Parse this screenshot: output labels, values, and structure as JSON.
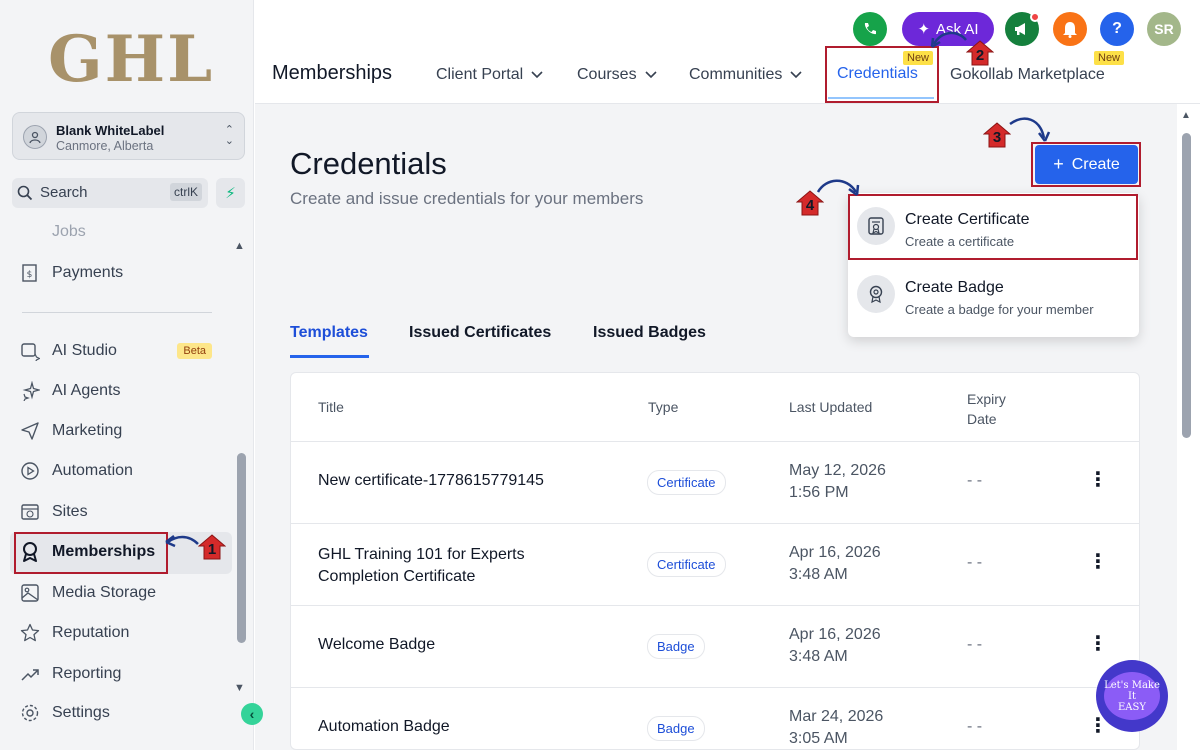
{
  "sidebar": {
    "logo": "GHL",
    "account": {
      "name": "Blank WhiteLabel",
      "location": "Canmore, Alberta"
    },
    "search": {
      "label": "Search",
      "shortcut": "ctrlK"
    },
    "items": [
      {
        "label": "Jobs"
      },
      {
        "label": "Payments"
      },
      {
        "label": "AI Studio",
        "badge": "Beta"
      },
      {
        "label": "AI Agents"
      },
      {
        "label": "Marketing"
      },
      {
        "label": "Automation"
      },
      {
        "label": "Sites"
      },
      {
        "label": "Memberships"
      },
      {
        "label": "Media Storage"
      },
      {
        "label": "Reputation"
      },
      {
        "label": "Reporting"
      },
      {
        "label": "Settings"
      }
    ]
  },
  "header": {
    "title": "Memberships",
    "tabs": [
      {
        "label": "Client Portal"
      },
      {
        "label": "Courses"
      },
      {
        "label": "Communities"
      },
      {
        "label": "Credentials",
        "tag": "New"
      },
      {
        "label": "Gokollab Marketplace",
        "tag": "New"
      }
    ],
    "ask_ai": "Ask AI",
    "avatar": "SR",
    "help": "?"
  },
  "page": {
    "title": "Credentials",
    "subtitle": "Create and issue credentials for your members",
    "create_label": "Create",
    "dropdown": [
      {
        "title": "Create Certificate",
        "desc": "Create a certificate"
      },
      {
        "title": "Create Badge",
        "desc": "Create a badge for your member"
      }
    ],
    "tabs": [
      "Templates",
      "Issued Certificates",
      "Issued Badges"
    ]
  },
  "table": {
    "headers": {
      "title": "Title",
      "type": "Type",
      "updated": "Last Updated",
      "expiry_line1": "Expiry",
      "expiry_line2": "Date"
    },
    "rows": [
      {
        "title_line1": "New certificate-1778615779145",
        "title_line2": "",
        "type": "Certificate",
        "date": "May 12, 2026",
        "time": "1:56 PM",
        "expiry": "- -"
      },
      {
        "title_line1": "GHL Training 101 for Experts",
        "title_line2": "Completion Certificate",
        "type": "Certificate",
        "date": "Apr 16, 2026",
        "time": "3:48 AM",
        "expiry": "- -"
      },
      {
        "title_line1": "Welcome Badge",
        "title_line2": "",
        "type": "Badge",
        "date": "Apr 16, 2026",
        "time": "3:48 AM",
        "expiry": "- -"
      },
      {
        "title_line1": "Automation Badge",
        "title_line2": "",
        "type": "Badge",
        "date": "Mar 24, 2026",
        "time": "3:05 AM",
        "expiry": "- -"
      }
    ]
  },
  "annotations": {
    "n1": "1",
    "n2": "2",
    "n3": "3",
    "n4": "4"
  },
  "watermark": {
    "line1": "Let's Make",
    "line2": "It",
    "line3": "EASY"
  },
  "colors": {
    "primary": "#2563eb",
    "annotation": "#b01c2e",
    "accent_green": "#10b981"
  }
}
